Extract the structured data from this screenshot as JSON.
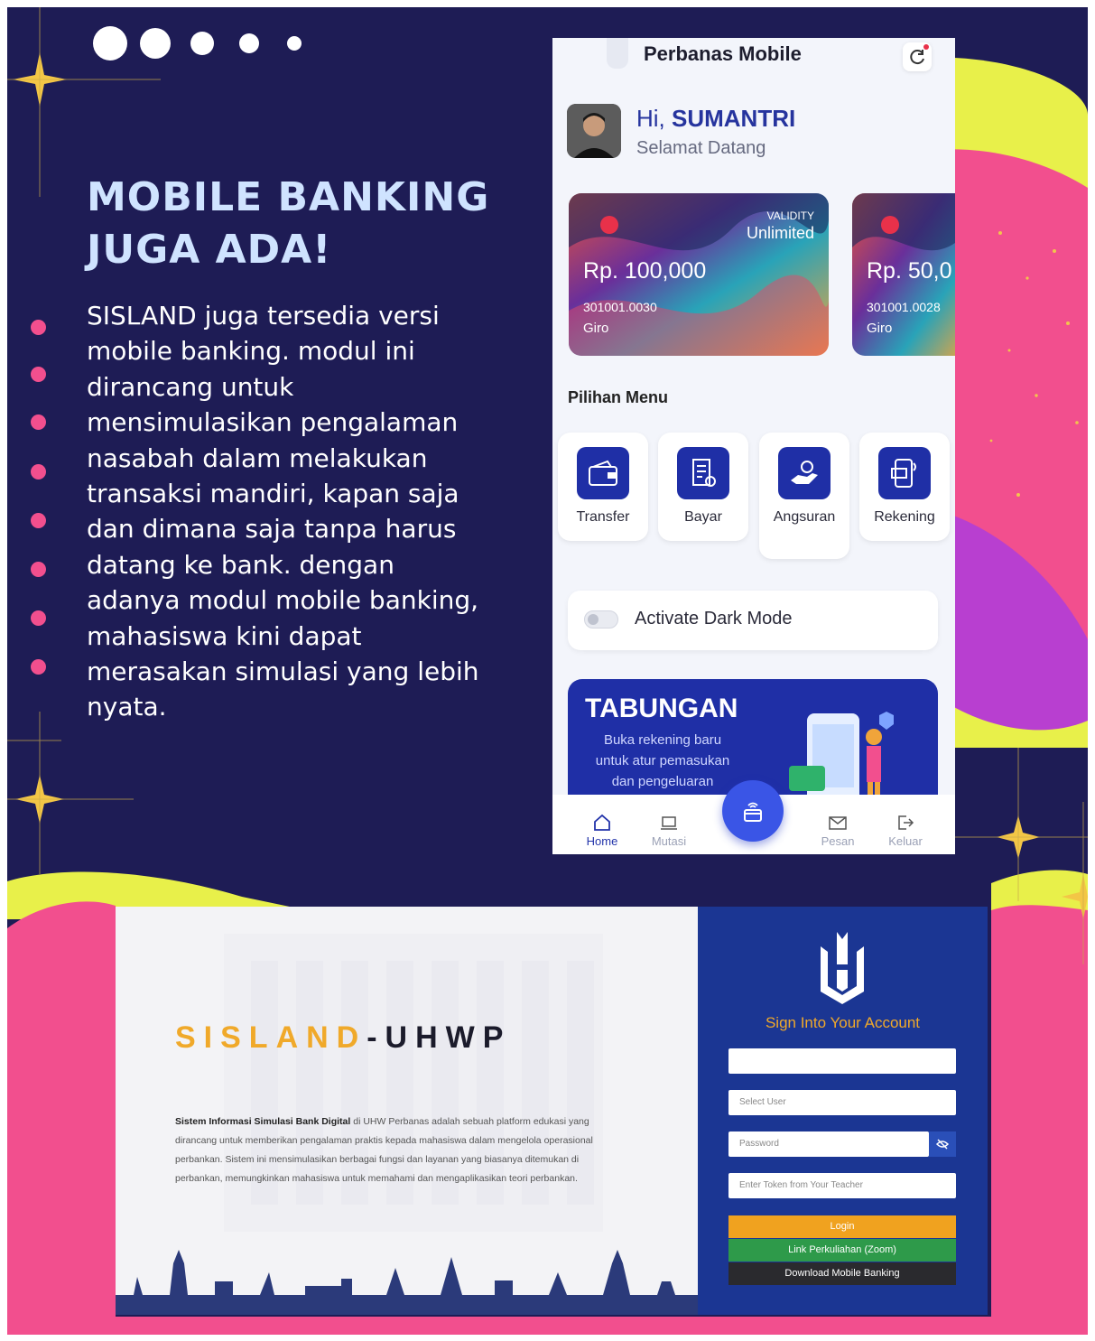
{
  "headline": {
    "line1": "MOBILE BANKING",
    "line2": "JUGA ADA!"
  },
  "body": "SISLAND  juga tersedia versi mobile banking. modul ini dirancang untuk mensimulasikan pengalaman nasabah dalam melakukan transaksi mandiri, kapan saja dan dimana saja tanpa harus datang ke bank. dengan adanya modul mobile banking, mahasiswa kini dapat merasakan simulasi yang lebih  nyata.",
  "phone": {
    "title": "Perbanas Mobile",
    "refresh_icon": "refresh-icon",
    "greeting_prefix": "Hi, ",
    "user_name": "SUMANTRI",
    "welcome": "Selamat Datang",
    "cards": [
      {
        "amount": "Rp. 100,000",
        "account": "301001.0030",
        "type": "Giro",
        "validity_label": "VALIDITY",
        "validity_value": "Unlimited"
      },
      {
        "amount": "Rp. 50,0",
        "account": "301001.0028",
        "type": "Giro"
      }
    ],
    "menu_title": "Pilihan Menu",
    "menu": [
      {
        "label": "Transfer",
        "icon": "wallet-icon"
      },
      {
        "label": "Bayar",
        "icon": "bill-icon"
      },
      {
        "label": "Angsuran",
        "icon": "hand-coin-icon"
      },
      {
        "label": "Rekening",
        "icon": "account-device-icon"
      }
    ],
    "dark_mode": {
      "label": "Activate Dark Mode",
      "enabled": false
    },
    "banner": {
      "title": "TABUNGAN",
      "text": "Buka rekening baru untuk atur pemasukan dan pengeluaran"
    },
    "nav": [
      {
        "label": "Home",
        "icon": "home-icon",
        "active": true
      },
      {
        "label": "Mutasi",
        "icon": "laptop-icon",
        "active": false
      },
      {
        "label": "Pesan",
        "icon": "mail-icon",
        "active": false
      },
      {
        "label": "Keluar",
        "icon": "logout-icon",
        "active": false
      }
    ],
    "fab_icon": "nfc-card-icon"
  },
  "login": {
    "brand_part1": "SISLAND",
    "brand_part2": "-UHWP",
    "description_bold": "Sistem Informasi Simulasi Bank Digital",
    "description": " di UHW Perbanas adalah sebuah platform edukasi yang dirancang untuk memberikan pengalaman praktis kepada mahasiswa dalam mengelola operasional perbankan. Sistem ini mensimulasikan berbagai fungsi dan layanan yang biasanya ditemukan di perbankan, memungkinkan mahasiswa untuk memahami dan mengaplikasikan teori perbankan.",
    "signin_title": "Sign Into Your Account",
    "select_user_placeholder": "Select User",
    "password_placeholder": "Password",
    "token_placeholder": "Enter Token from Your Teacher",
    "login_button": "Login",
    "zoom_button": "Link Perkuliahan (Zoom)",
    "download_button": "Download Mobile Banking"
  },
  "colors": {
    "navy": "#1e1c55",
    "pink": "#f24f8e",
    "yellow": "#e8f04a",
    "accent_blue": "#1f2fa6",
    "gold": "#f0a92a"
  }
}
